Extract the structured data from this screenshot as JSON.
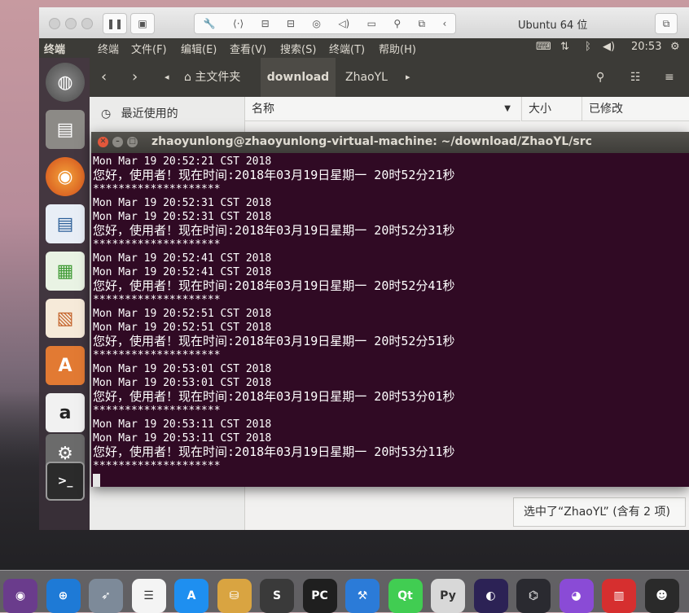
{
  "vm": {
    "title": "Ubuntu 64 位",
    "toolbar_icons": [
      "pause-icon",
      "snapshot-icon",
      "settings-wrench-icon",
      "network-arrows-icon",
      "harddisk-icon",
      "harddisk2-icon",
      "camera-icon",
      "sound-icon",
      "video-icon",
      "usb-icon",
      "share-folder-icon",
      "collapse-icon"
    ]
  },
  "panel": {
    "app_name": "终端",
    "menus": [
      "终端",
      "文件(F)",
      "编辑(E)",
      "查看(V)",
      "搜索(S)",
      "终端(T)",
      "帮助(H)"
    ],
    "time": "20:53"
  },
  "file_manager": {
    "breadcrumbs": [
      "主文件夹",
      "download",
      "ZhaoYL"
    ],
    "sidebar_recent": "最近使用的",
    "columns": [
      "名称",
      "大小",
      "已修改"
    ],
    "status": "选中了“ZhaoYL” (含有 2 项)"
  },
  "terminal": {
    "title": "zhaoyunlong@zhaoyunlong-virtual-machine: ~/download/ZhaoYL/src",
    "lines": [
      "Mon Mar 19 20:52:21 CST 2018",
      "您好，使用者！现在时间:2018年03月19日星期一 20时52分21秒",
      "********************",
      "Mon Mar 19 20:52:31 CST 2018",
      "Mon Mar 19 20:52:31 CST 2018",
      "您好，使用者！现在时间:2018年03月19日星期一 20时52分31秒",
      "********************",
      "Mon Mar 19 20:52:41 CST 2018",
      "Mon Mar 19 20:52:41 CST 2018",
      "您好，使用者！现在时间:2018年03月19日星期一 20时52分41秒",
      "********************",
      "Mon Mar 19 20:52:51 CST 2018",
      "Mon Mar 19 20:52:51 CST 2018",
      "您好，使用者！现在时间:2018年03月19日星期一 20时52分51秒",
      "********************",
      "Mon Mar 19 20:53:01 CST 2018",
      "Mon Mar 19 20:53:01 CST 2018",
      "您好，使用者！现在时间:2018年03月19日星期一 20时53分01秒",
      "********************",
      "Mon Mar 19 20:53:11 CST 2018",
      "Mon Mar 19 20:53:11 CST 2018",
      "您好，使用者！现在时间:2018年03月19日星期一 20时53分11秒",
      "********************"
    ]
  },
  "launcher": {
    "items": [
      "ubuntu-dash-icon",
      "files-icon",
      "firefox-icon",
      "writer-icon",
      "calc-icon",
      "impress-icon",
      "software-center-icon",
      "amazon-icon",
      "system-settings-icon",
      "terminal-icon"
    ]
  },
  "dock": {
    "items": [
      {
        "name": "siri-icon",
        "glyph": "◉",
        "color": "#6a3c8c"
      },
      {
        "name": "safari-icon",
        "glyph": "⊕",
        "color": "#1e7ad6"
      },
      {
        "name": "launchpad-icon",
        "glyph": "➶",
        "color": "#7d8a99"
      },
      {
        "name": "reminders-icon",
        "glyph": "☰",
        "color": "#f4f4f4"
      },
      {
        "name": "app-store-icon",
        "glyph": "A",
        "color": "#1e8ff0"
      },
      {
        "name": "sequel-pro-icon",
        "glyph": "⛁",
        "color": "#d9a441"
      },
      {
        "name": "sublime-text-icon",
        "glyph": "S",
        "color": "#3a3a3a"
      },
      {
        "name": "pycharm-icon",
        "glyph": "PC",
        "color": "#1f1f1f"
      },
      {
        "name": "xcode-icon",
        "glyph": "⚒",
        "color": "#2b7bd8"
      },
      {
        "name": "qt-creator-icon",
        "glyph": "Qt",
        "color": "#41cd52"
      },
      {
        "name": "python-icon",
        "glyph": "Py",
        "color": "#d8d8d8"
      },
      {
        "name": "eclipse-icon",
        "glyph": "◐",
        "color": "#2c2255"
      },
      {
        "name": "vscode-icon",
        "glyph": "⌬",
        "color": "#2a2a30"
      },
      {
        "name": "github-desktop-icon",
        "glyph": "◕",
        "color": "#8a4bd6"
      },
      {
        "name": "parallels-icon",
        "glyph": "▥",
        "color": "#d62f2f"
      },
      {
        "name": "qq-icon",
        "glyph": "☻",
        "color": "#2a2a2a"
      }
    ]
  }
}
